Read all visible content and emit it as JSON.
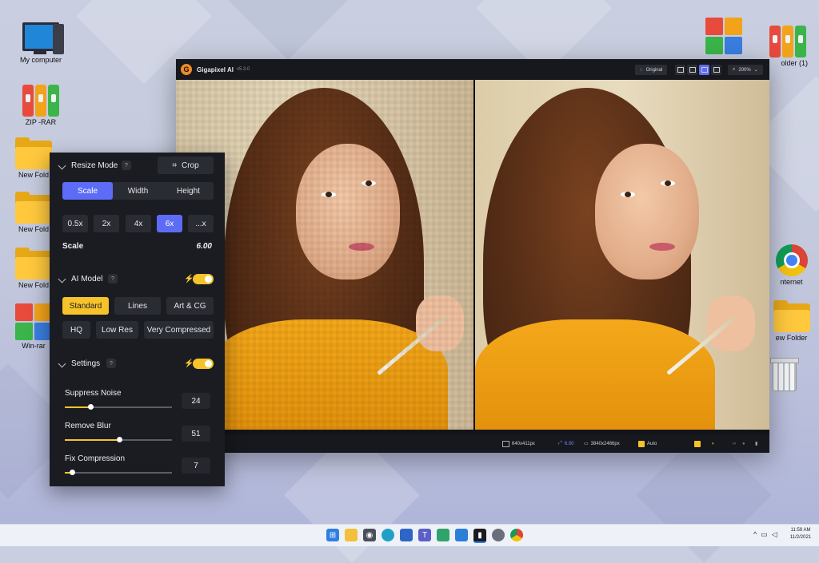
{
  "desktop": {
    "icons_left": [
      {
        "label": "My computer",
        "icon": "computer-icon"
      },
      {
        "label": "ZIP -RAR",
        "icon": "archive-binders-icon"
      },
      {
        "label": "New Fold",
        "icon": "folder-icon"
      },
      {
        "label": "New Fold",
        "icon": "folder-icon"
      },
      {
        "label": "New Fold",
        "icon": "folder-icon"
      },
      {
        "label": "Win-rar",
        "icon": "winrar-icon"
      }
    ],
    "icons_right": [
      {
        "label": "",
        "icon": "winrar-icon"
      },
      {
        "label": "older (1)",
        "icon": "archive-binders-icon"
      },
      {
        "label": "nternet",
        "icon": "chrome-icon"
      },
      {
        "label": "ew Folder",
        "icon": "folder-icon"
      },
      {
        "label": "",
        "icon": "recycle-bin-icon"
      }
    ]
  },
  "app": {
    "name": "Gigapixel AI",
    "version": "v5.3.0",
    "logo_letter": "G",
    "original_label": "Original",
    "zoom_label": "200%",
    "status": {
      "input_size": "640x411px",
      "scale": "6.00",
      "output_size": "3840x2466px",
      "mode": "Auto"
    }
  },
  "panel": {
    "resize_mode": {
      "title": "Resize Mode",
      "help": "?",
      "crop_label": "Crop",
      "tabs": [
        "Scale",
        "Width",
        "Height"
      ],
      "active_tab": "Scale",
      "scales": [
        "0.5x",
        "2x",
        "4x",
        "6x",
        "...x"
      ],
      "active_scale": "6x",
      "scale_label": "Scale",
      "scale_value": "6.00"
    },
    "ai_model": {
      "title": "AI Model",
      "help": "?",
      "enabled": true,
      "models_row1": [
        "Standard",
        "Lines",
        "Art & CG"
      ],
      "models_row2": [
        "HQ",
        "Low Res",
        "Very Compressed"
      ],
      "active_model": "Standard"
    },
    "settings": {
      "title": "Settings",
      "help": "?",
      "enabled": true,
      "sliders": [
        {
          "label": "Suppress Noise",
          "value": "24",
          "fraction": 0.24
        },
        {
          "label": "Remove Blur",
          "value": "51",
          "fraction": 0.51
        },
        {
          "label": "Fix Compression",
          "value": "7",
          "fraction": 0.07
        }
      ]
    }
  },
  "taskbar": {
    "time": "11:59 AM",
    "date": "11/2/2021",
    "apps": [
      "windows-start-icon",
      "file-explorer-icon",
      "camera-icon",
      "edge-icon",
      "store-icon",
      "teams-icon",
      "maps-icon",
      "photos-icon",
      "gigapixel-icon",
      "settings-icon",
      "chrome-icon"
    ]
  },
  "colors": {
    "accent_blue": "#5d6cf6",
    "accent_yellow": "#f6c32a",
    "panel_bg": "#1b1c22"
  }
}
